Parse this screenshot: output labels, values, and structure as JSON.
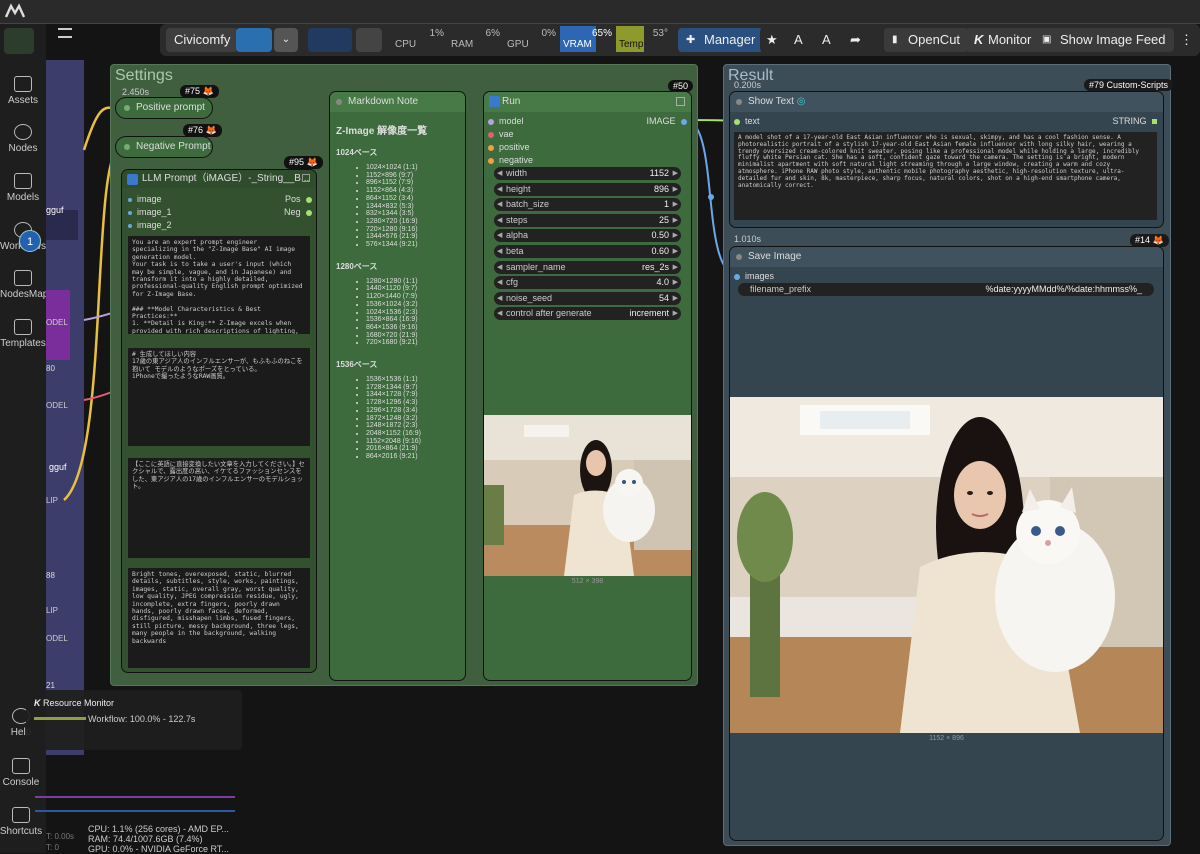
{
  "toolbar": {
    "civicomfy": "Civicomfy",
    "manager": "Manager",
    "opencut": "OpenCut",
    "monitor": "Monitor",
    "image_feed": "Show Image Feed",
    "colors": {
      "vram_bar": "#2d67b4",
      "temp_bar": "#8e9a2b",
      "manager_bg": "#2a5080"
    }
  },
  "resources": [
    {
      "label": "CPU",
      "value": "1%"
    },
    {
      "label": "RAM",
      "value": "6%"
    },
    {
      "label": "GPU",
      "value": "0%"
    },
    {
      "label": "VRAM",
      "value": "65%"
    },
    {
      "label": "Temp",
      "value": "53°"
    }
  ],
  "sidebar": {
    "items": [
      "Assets",
      "Nodes",
      "Models",
      "Workflows",
      "NodesMap",
      "Templates"
    ],
    "bottom": [
      "Help",
      "Console",
      "Shortcuts"
    ],
    "workflows_badge": "1"
  },
  "left_fragments": {
    "gguf1": "gguf",
    "gguf2": "gguf",
    "odel1": "ODEL",
    "odel2": "ODEL",
    "odel3": "ODEL",
    "lip1": "LIP",
    "lip2": "LIP",
    "n80": "80",
    "n88": "88",
    "n21": "21"
  },
  "settings": {
    "title": "Settings",
    "timing": "2.450s",
    "pos_prompt": {
      "title": "Positive prompt",
      "id": "#75"
    },
    "neg_prompt": {
      "title": "Negative Prompt",
      "id": "#76"
    },
    "llm": {
      "id": "#95",
      "title": "LLM Prompt（iMAGE）-_String__B...",
      "inputs": [
        "image",
        "image_1",
        "image_2"
      ],
      "outputs": [
        "Pos",
        "Neg"
      ],
      "system_prompt": "You are an expert prompt engineer specializing in the \"Z-Image Base\" AI image generation model.\nYour task is to take a user's input (which may be simple, vague, and in Japanese) and transform it into a highly detailed, professional-quality English prompt optimized for Z-Image Base.\n\n### **Model Characteristics & Best Practices:**\n1. **Detail is King:** Z-Image excels when provided with rich descriptions of lighting, texture, camera angles, and atmosphere.\n2. **Anatomy & Realism:** It has strong anatomical understanding. Describe physical features clearly.\n3. **Style Specifics:** It handles both photorealistic and anime styles well. Explicitly",
      "user_request": "# 生成してほしい内容\n17歳の東アジア人のインフルエンサーが、もふもふのねこを抱いて モデルのようなポーズをとっている。\niPhoneで撮ったようなRAW画質。",
      "jp_note": "【ここに英語に直接変換したい文章を入力してください。】セクシャルで、露出度の高い、イケてるファッションセンスをした、東アジア人の17歳のインフルエンサーのモデルショット。",
      "negative": "Bright tones, overexposed, static, blurred details, subtitles, style, works, paintings, images, static, overall gray, worst quality, low quality, JPEG compression residue, ugly, incomplete, extra fingers, poorly drawn hands, poorly drawn faces, deformed, disfigured, misshapen limbs, fused fingers, still picture, messy background, three legs, many people in the background, walking backwards"
    },
    "markdown": {
      "title": "Markdown Note",
      "heading": "Z-Image 解像度一覧",
      "sections": [
        {
          "name": "1024ベース",
          "items": [
            "1024×1024 (1:1)",
            "1152×896 (9:7)",
            "896×1152 (7:9)",
            "1152×864 (4:3)",
            "864×1152 (3:4)",
            "1344×832 (5:3)",
            "832×1344 (3:5)",
            "1280×720 (16:9)",
            "720×1280 (9:16)",
            "1344×576 (21:9)",
            "576×1344 (9:21)"
          ]
        },
        {
          "name": "1280ベース",
          "items": [
            "1280×1280 (1:1)",
            "1440×1120 (9:7)",
            "1120×1440 (7:9)",
            "1536×1024 (3:2)",
            "1024×1536 (2:3)",
            "1536×864 (16:9)",
            "864×1536 (9:16)",
            "1680×720 (21:9)",
            "720×1680 (9:21)"
          ]
        },
        {
          "name": "1536ベース",
          "items": [
            "1536×1536 (1:1)",
            "1728×1344 (9:7)",
            "1344×1728 (7:9)",
            "1728×1296 (4:3)",
            "1296×1728 (3:4)",
            "1872×1248 (3:2)",
            "1248×1872 (2:3)",
            "2048×1152 (16:9)",
            "1152×2048 (9:16)",
            "2016×864 (21:9)",
            "864×2016 (9:21)"
          ]
        }
      ]
    },
    "run": {
      "id": "#50",
      "title": "Run",
      "inputs": [
        "model",
        "vae",
        "positive",
        "negative"
      ],
      "output": "IMAGE",
      "widgets": [
        {
          "name": "width",
          "value": "1152"
        },
        {
          "name": "height",
          "value": "896"
        },
        {
          "name": "batch_size",
          "value": "1"
        },
        {
          "name": "steps",
          "value": "25"
        },
        {
          "name": "alpha",
          "value": "0.50"
        },
        {
          "name": "beta",
          "value": "0.60"
        },
        {
          "name": "sampler_name",
          "value": "res_2s"
        },
        {
          "name": "cfg",
          "value": "4.0"
        },
        {
          "name": "noise_seed",
          "value": "54"
        },
        {
          "name": "control after generate",
          "value": "increment"
        }
      ],
      "preview_size": "512 × 398"
    }
  },
  "result": {
    "title": "Result",
    "timing_top": "0.200s",
    "custom_scripts": "#79 Custom-Scripts",
    "show_text": {
      "title": "Show Text",
      "input": "text",
      "output": "STRING",
      "content": "A model shot of a 17-year-old East Asian influencer who is sexual, skimpy, and has a cool fashion sense. A photorealistic portrait of a stylish 17-year-old East Asian female influencer with long silky hair, wearing a trendy oversized cream-colored knit sweater, posing like a professional model while holding a large, incredibly fluffy white Persian cat. She has a soft, confident gaze toward the camera. The setting is a bright, modern minimalist apartment with soft natural light streaming through a large window, creating a warm and cozy atmosphere. iPhone RAW photo style, authentic mobile photography aesthetic, high-resolution texture, ultra-detailed fur and skin, 8k, masterpiece, sharp focus, natural colors, shot on a high-end smartphone camera, anatomically correct."
    },
    "save": {
      "id": "#14",
      "timing": "1.010s",
      "title": "Save Image",
      "input": "images",
      "prefix_label": "filename_prefix",
      "prefix_value": "%date:yyyyMMdd%/%date:hhmmss%_",
      "size": "1152 × 896"
    }
  },
  "monitor": {
    "title": "Resource Monitor",
    "workflow": "Workflow: 100.0% - 122.7s",
    "cpu": "CPU: 1.1% (256 cores) - AMD EP...",
    "ram": "RAM: 74.4/1007.6GB (7.4%)",
    "gpu": "GPU: 0.0% - NVIDIA GeForce RT...",
    "t1": "T: 0.00s",
    "t2": "T: 0"
  }
}
